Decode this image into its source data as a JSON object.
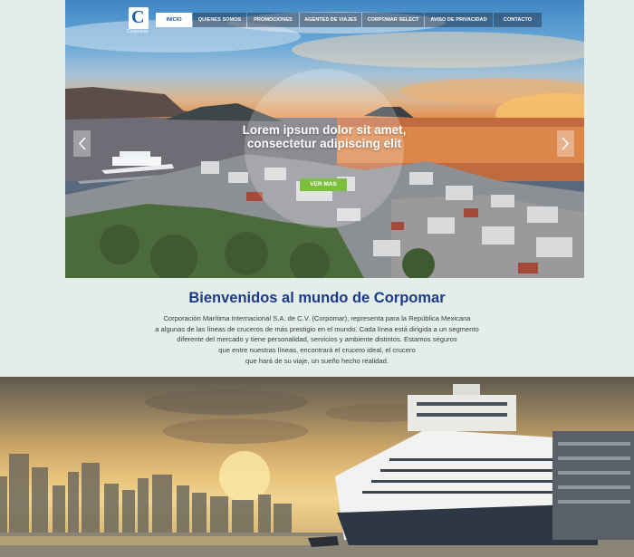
{
  "brand": {
    "logo_text": "Corpomar"
  },
  "nav": {
    "items": [
      {
        "label": "INICIO",
        "active": true
      },
      {
        "label": "QUIENES SOMOS",
        "active": false
      },
      {
        "label": "PROMOCIONES",
        "active": false
      },
      {
        "label": "AGENTES DE VIAJES",
        "active": false
      },
      {
        "label": "CORPOMAR SELECT",
        "active": false
      },
      {
        "label": "AVISO DE PRIVACIDAD",
        "active": false
      },
      {
        "label": "CONTACTO",
        "active": false
      }
    ]
  },
  "hero": {
    "headline": "Lorem ipsum dolor sit amet, consectetur adipiscing elit",
    "cta_label": "VER MAS",
    "prev_icon": "chevron-left-icon",
    "next_icon": "chevron-right-icon"
  },
  "welcome": {
    "title": "Bienvenidos al mundo de Corpomar",
    "lines": [
      "Corporación Marítima Internacional S.A. de C.V. (Corpomar), representa para la República Mexicana",
      "a algunas de las líneas de cruceros de más prestigio en el mundo. Cada línea está dirigida a un segmento",
      "diferente del mercado y tiene personalidad, servicios y ambiente distintos. Estamos seguros",
      "que entre nuestras líneas, encontrará el crucero ideal, el crucero",
      "que hará de su viaje, un sueño hecho realidad."
    ]
  },
  "colors": {
    "background": "#e3eeea",
    "title": "#1d3a8a",
    "nav_active_text": "#1d4f93",
    "cta": "#7cbf3a"
  }
}
